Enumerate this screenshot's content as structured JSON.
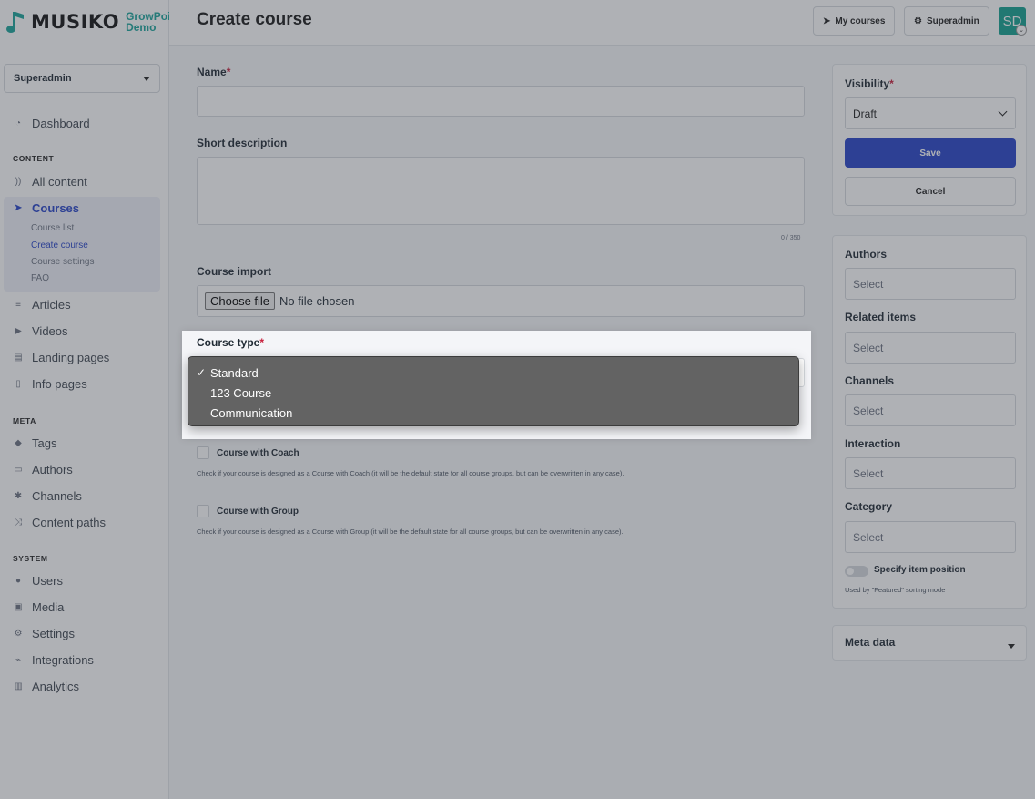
{
  "brand": {
    "name": "MUSIKO",
    "sub_line1": "GrowPoint",
    "sub_line2": "Demo"
  },
  "header": {
    "title": "Create course",
    "my_courses_label": "My courses",
    "superadmin_label": "Superadmin",
    "avatar_initials": "SD"
  },
  "sidebar": {
    "role": "Superadmin",
    "dashboard": "Dashboard",
    "content_heading": "CONTENT",
    "all_content": "All content",
    "courses": "Courses",
    "course_sub": [
      "Course list",
      "Create course",
      "Course settings",
      "FAQ"
    ],
    "articles": "Articles",
    "videos": "Videos",
    "landing_pages": "Landing pages",
    "info_pages": "Info pages",
    "meta_heading": "META",
    "tags": "Tags",
    "authors": "Authors",
    "channels": "Channels",
    "content_paths": "Content paths",
    "system_heading": "SYSTEM",
    "users": "Users",
    "media": "Media",
    "settings": "Settings",
    "integrations": "Integrations",
    "analytics": "Analytics"
  },
  "form": {
    "name_label": "Name",
    "short_desc_label": "Short description",
    "counter": "0 / 350",
    "import_label": "Course import",
    "choose_file": "Choose file",
    "no_file": "No file chosen",
    "course_type_label": "Course type",
    "course_type_options": [
      "Standard",
      "123 Course",
      "Communication"
    ],
    "course_type_selected": "Standard",
    "coach_label": "Course with Coach",
    "coach_hint": "Check if your course is designed as a Course with Coach (it will be the default state for all course groups, but can be overwritten in any case).",
    "group_label": "Course with Group",
    "group_hint": "Check if your course is designed as a Course with Group (it will be the default state for all course groups, but can be overwritten in any case)."
  },
  "right": {
    "visibility_label": "Visibility",
    "visibility_value": "Draft",
    "save": "Save",
    "cancel": "Cancel",
    "authors_label": "Authors",
    "related_label": "Related items",
    "channels_label": "Channels",
    "interaction_label": "Interaction",
    "category_label": "Category",
    "select_placeholder": "Select",
    "position_label": "Specify item position",
    "position_hint": "Used by \"Featured\" sorting mode",
    "meta_label": "Meta data"
  },
  "colors": {
    "accent": "#2744c8",
    "brand_teal": "#1aa39a",
    "required": "#c81e3b",
    "dropdown_bg": "#636363"
  }
}
